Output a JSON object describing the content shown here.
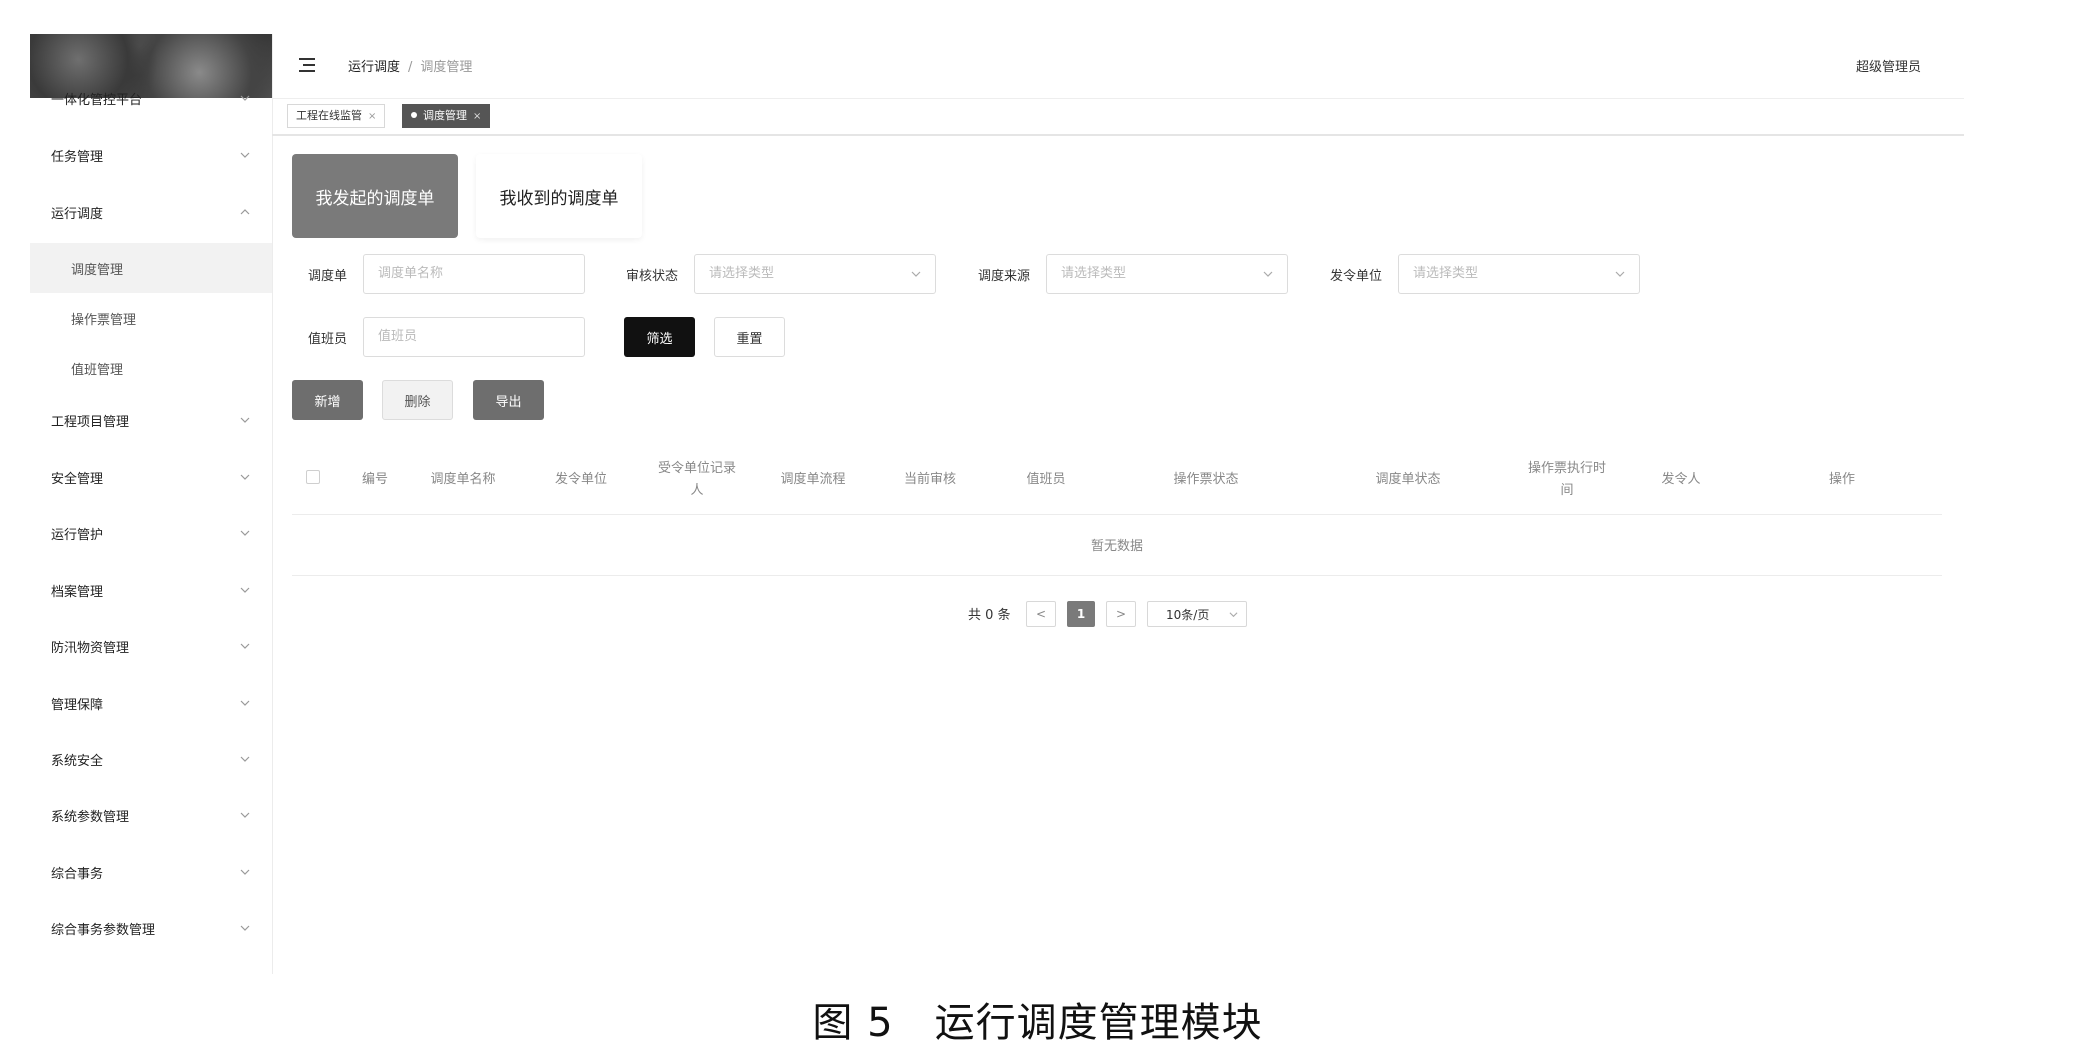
{
  "sidebar": {
    "items": [
      {
        "label": "一体化管控平台",
        "arrow": "down"
      },
      {
        "label": "任务管理",
        "arrow": "down"
      },
      {
        "label": "运行调度",
        "arrow": "up"
      },
      {
        "label": "调度管理",
        "sub": true,
        "active": true
      },
      {
        "label": "操作票管理",
        "sub": true
      },
      {
        "label": "值班管理",
        "sub": true
      },
      {
        "label": "工程项目管理",
        "arrow": "down"
      },
      {
        "label": "安全管理",
        "arrow": "down"
      },
      {
        "label": "运行管护",
        "arrow": "down"
      },
      {
        "label": "档案管理",
        "arrow": "down"
      },
      {
        "label": "防汛物资管理",
        "arrow": "down"
      },
      {
        "label": "管理保障",
        "arrow": "down"
      },
      {
        "label": "系统安全",
        "arrow": "down"
      },
      {
        "label": "系统参数管理",
        "arrow": "down"
      },
      {
        "label": "综合事务",
        "arrow": "down"
      },
      {
        "label": "综合事务参数管理",
        "arrow": "down"
      }
    ]
  },
  "header": {
    "breadcrumb_parent": "运行调度",
    "breadcrumb_sep": "/",
    "breadcrumb_current": "调度管理",
    "user": "超级管理员"
  },
  "tabs": [
    {
      "label": "工程在线监管",
      "close": "×"
    },
    {
      "label": "调度管理",
      "close": "×",
      "active": true
    }
  ],
  "segments": {
    "sent": "我发起的调度单",
    "received": "我收到的调度单"
  },
  "filters": {
    "order_label": "调度单",
    "order_placeholder": "调度单名称",
    "audit_label": "审核状态",
    "audit_placeholder": "请选择类型",
    "source_label": "调度来源",
    "source_placeholder": "请选择类型",
    "unit_label": "发令单位",
    "unit_placeholder": "请选择类型",
    "duty_label": "值班员",
    "duty_placeholder": "值班员",
    "filter_btn": "筛选",
    "reset_btn": "重置"
  },
  "actions": {
    "add": "新增",
    "delete": "删除",
    "export": "导出"
  },
  "table": {
    "columns": [
      {
        "l1": "编号",
        "l2": ""
      },
      {
        "l1": "调度单名称",
        "l2": ""
      },
      {
        "l1": "发令单位",
        "l2": ""
      },
      {
        "l1": "受令单位记录",
        "l2": "人"
      },
      {
        "l1": "调度单流程",
        "l2": ""
      },
      {
        "l1": "当前审核",
        "l2": ""
      },
      {
        "l1": "值班员",
        "l2": ""
      },
      {
        "l1": "操作票状态",
        "l2": ""
      },
      {
        "l1": "调度单状态",
        "l2": ""
      },
      {
        "l1": "操作票执行时",
        "l2": "间"
      },
      {
        "l1": "发令人",
        "l2": ""
      },
      {
        "l1": "操作",
        "l2": ""
      }
    ],
    "empty": "暂无数据"
  },
  "pagination": {
    "total": "共 0 条",
    "prev": "<",
    "current": "1",
    "next": ">",
    "page_size": "10条/页"
  },
  "caption": "图 5　运行调度管理模块",
  "colors": {
    "active_segment": "#7a7a7a",
    "primary_button": "#111111",
    "gray_button": "#6e6e6e"
  }
}
